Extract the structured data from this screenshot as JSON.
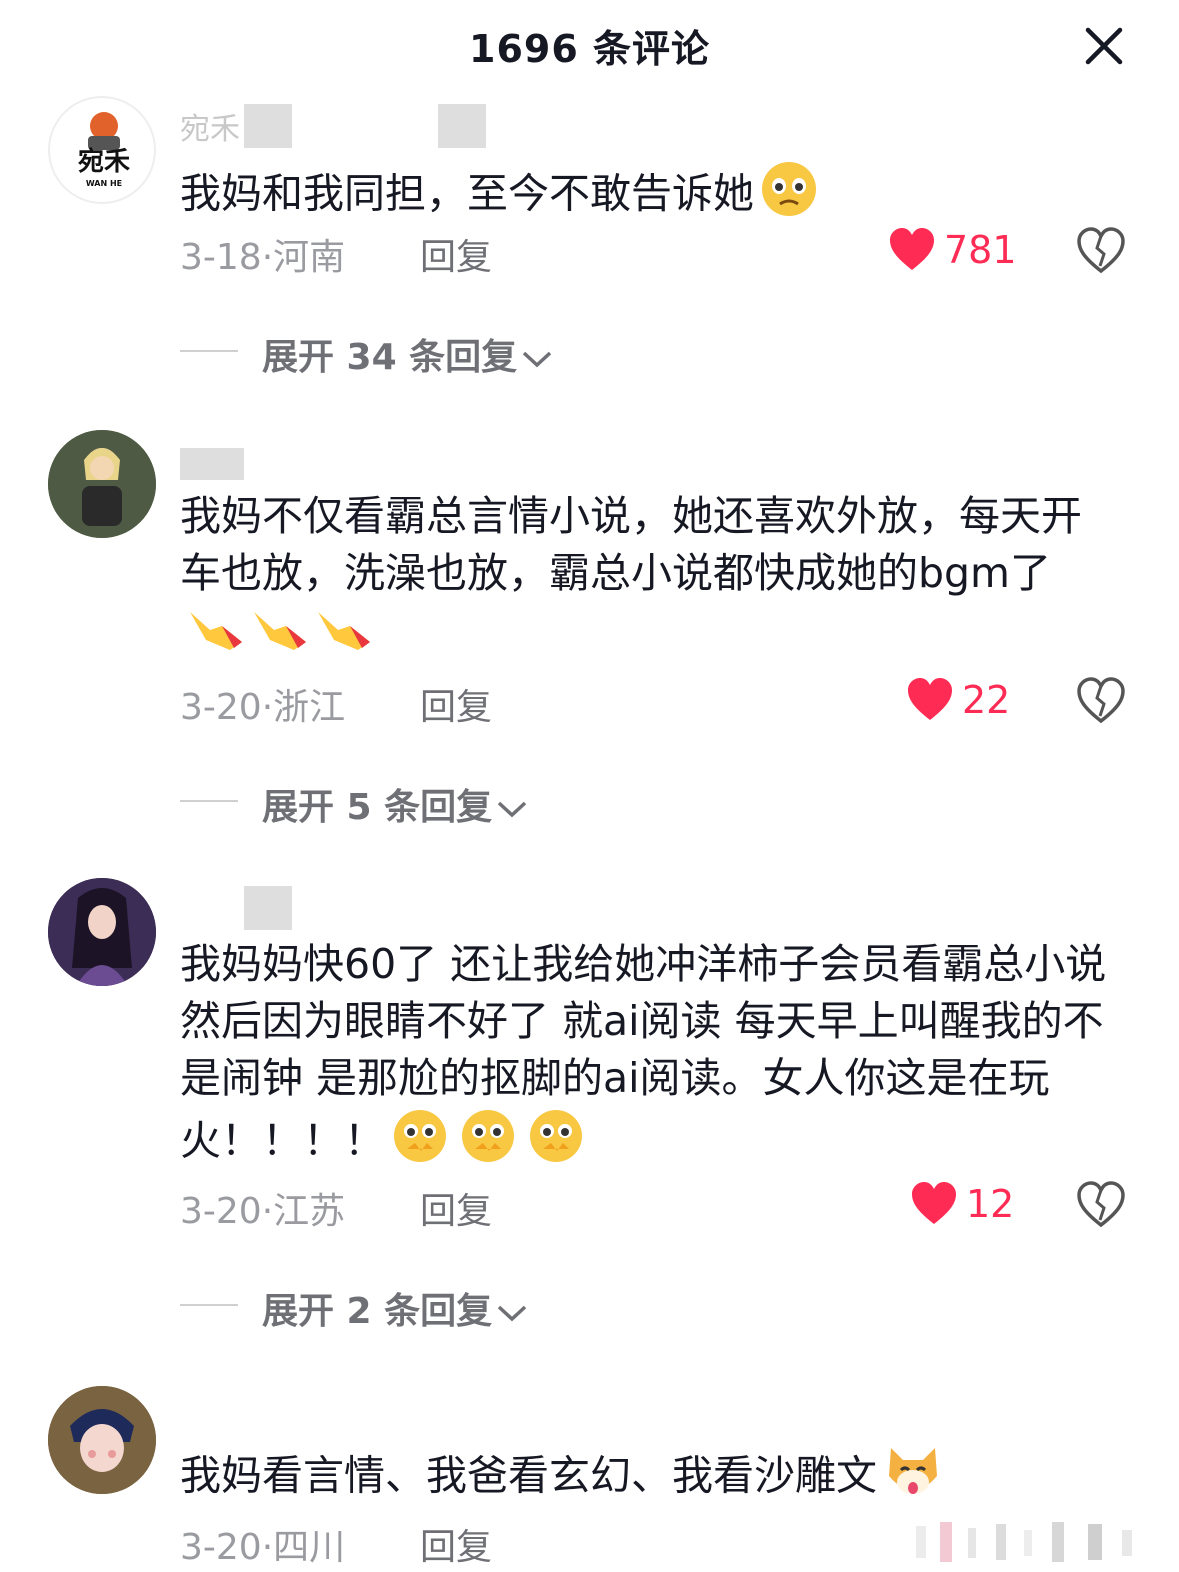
{
  "header": {
    "title": "1696 条评论"
  },
  "comments": [
    {
      "username": "宛禾",
      "text": "我妈和我同担，至今不敢告诉她",
      "date": "3-18",
      "location": "河南",
      "reply_label": "回复",
      "likes": "781",
      "expand_label": "展开 34 条回复"
    },
    {
      "username": "",
      "text": "我妈不仅看霸总言情小说，她还喜欢外放，每天开车也放，洗澡也放，霸总小说都快成她的bgm了",
      "date": "3-20",
      "location": "浙江",
      "reply_label": "回复",
      "likes": "22",
      "expand_label": "展开 5 条回复"
    },
    {
      "username": "",
      "text": "我妈妈快60了 还让我给她冲洋柿子会员看霸总小说 然后因为眼睛不好了 就ai阅读   每天早上叫醒我的不是闹钟 是那尬的抠脚的ai阅读。女人你这是在玩火！！！！",
      "date": "3-20",
      "location": "江苏",
      "reply_label": "回复",
      "likes": "12",
      "expand_label": "展开 2 条回复"
    },
    {
      "username": "",
      "text": "我妈看言情、我爸看玄幻、我看沙雕文",
      "date": "3-20",
      "location": "四川",
      "reply_label": "回复"
    }
  ],
  "avatar1_logo": {
    "cn": "宛禾",
    "en": "WAN HE"
  },
  "colors": {
    "like": "#fe2c55",
    "meta": "#9a9ba0",
    "text": "#161823"
  }
}
